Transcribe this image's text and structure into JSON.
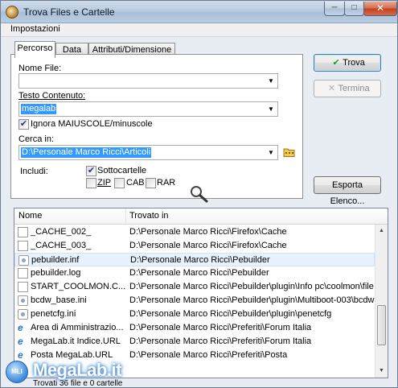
{
  "window": {
    "title": "Trova Files e Cartelle",
    "minimize": "─",
    "maximize": "□",
    "close": "✕"
  },
  "menu": {
    "items": [
      "Impostazioni"
    ]
  },
  "tabs": [
    "Percorso",
    "Data",
    "Attributi/Dimensione"
  ],
  "form": {
    "nome_file_label": "Nome File:",
    "nome_file_value": "",
    "testo_label": "Testo Contenuto:",
    "testo_value": "megalab",
    "ignora_label": "Ignora MAIUSCOLE/minuscole",
    "ignora_checked": true,
    "cerca_label": "Cerca in:",
    "cerca_value": "D:\\Personale Marco Ricci\\Articoli",
    "includi_label": "Includi:",
    "sottocartelle_label": "Sottocartelle",
    "sottocartelle_checked": true,
    "zip_label": "ZIP",
    "cab_label": "CAB",
    "rar_label": "RAR"
  },
  "buttons": {
    "trova": "Trova",
    "trova_icon": "✔",
    "termina": "Termina",
    "termina_icon": "✕",
    "esporta": "Esporta Elenco..."
  },
  "results": {
    "col_nome": "Nome",
    "col_trovato": "Trovato in",
    "rows": [
      {
        "name": "_CACHE_002_",
        "path": "D:\\Personale Marco Ricci\\Firefox\\Cache",
        "icon": "file-icon"
      },
      {
        "name": "_CACHE_003_",
        "path": "D:\\Personale Marco Ricci\\Firefox\\Cache",
        "icon": "file-icon"
      },
      {
        "name": "pebuilder.inf",
        "path": "D:\\Personale Marco Ricci\\Pebuilder",
        "icon": "config-file-icon"
      },
      {
        "name": "pebuilder.log",
        "path": "D:\\Personale Marco Ricci\\Pebuilder",
        "icon": "file-icon"
      },
      {
        "name": "START_COOLMON.C...",
        "path": "D:\\Personale Marco Ricci\\Pebuilder\\plugin\\Info pc\\coolmon\\file",
        "icon": "file-icon"
      },
      {
        "name": "bcdw_base.ini",
        "path": "D:\\Personale Marco Ricci\\Pebuilder\\plugin\\Multiboot-003\\bcdw",
        "icon": "config-file-icon"
      },
      {
        "name": "penetcfg.ini",
        "path": "D:\\Personale Marco Ricci\\Pebuilder\\plugin\\penetcfg",
        "icon": "config-file-icon"
      },
      {
        "name": "Area di Amministrazio...",
        "path": "D:\\Personale Marco Ricci\\Preferiti\\Forum Italia",
        "icon": "internet-shortcut-icon"
      },
      {
        "name": "MegaLab.it  Indice.URL",
        "path": "D:\\Personale Marco Ricci\\Preferiti\\Forum Italia",
        "icon": "internet-shortcut-icon"
      },
      {
        "name": "Posta MegaLab.URL",
        "path": "D:\\Personale Marco Ricci\\Preferiti\\Posta",
        "icon": "internet-shortcut-icon"
      }
    ],
    "selected_index": 2
  },
  "status": {
    "text": "Trovati 36 file e 0 cartelle"
  },
  "watermark": {
    "text": "MegaLab.it",
    "logo": "MLI"
  }
}
